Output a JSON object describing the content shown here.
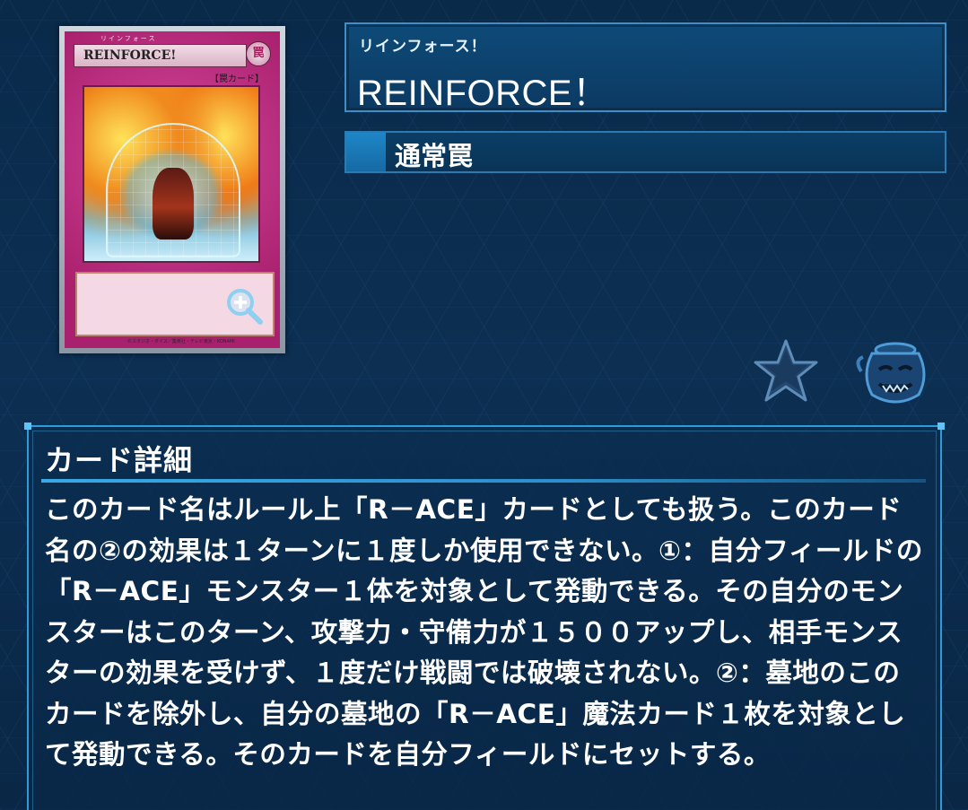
{
  "card_image": {
    "ruby": "リインフォース",
    "name": "REINFORCE!",
    "attribute": "罠",
    "type_label": "【罠カード】",
    "copyright": "©スタジオ・ダイス／集英社・テレビ東京・KONAMI"
  },
  "card_header": {
    "ruby": "リインフォース！",
    "name": "REINFORCE！",
    "type": "通常罠"
  },
  "colors": {
    "background": "#0b2c4e",
    "panel_border": "#3f8fc6",
    "type_swatch": "#1e86c7",
    "card_frame": "#c22c82"
  },
  "icons": {
    "favorite": "star-icon",
    "pot": "pot-of-greed-icon",
    "zoom": "magnify-plus-icon"
  },
  "detail": {
    "title": "カード詳細",
    "text": "このカード名はルール上「R－ACE」カードとしても扱う。このカード名の②の効果は１ターンに１度しか使用できない。①：自分フィールドの「R－ACE」モンスター１体を対象として発動できる。その自分のモンスターはこのターン、攻撃力・守備力が１５００アップし、相手モンスターの効果を受けず、１度だけ戦闘では破壊されない。②：墓地のこのカードを除外し、自分の墓地の「R－ACE」魔法カード１枚を対象として発動できる。そのカードを自分フィールドにセットする。"
  }
}
